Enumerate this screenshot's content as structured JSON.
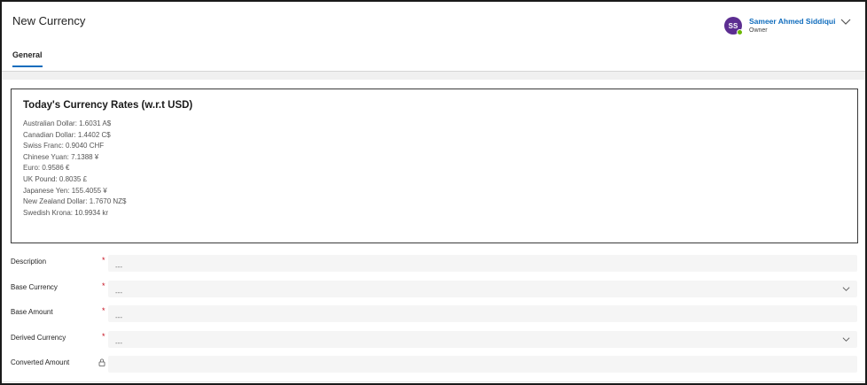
{
  "header": {
    "title": "New Currency",
    "owner": {
      "initials": "SS",
      "name": "Sameer Ahmed Siddiqui",
      "role": "Owner",
      "avatar_color": "#5c2d91",
      "presence_color": "#6bb700"
    },
    "tabs": [
      {
        "label": "General",
        "active": true
      }
    ]
  },
  "rates": {
    "title": "Today's Currency Rates (w.r.t USD)",
    "items": [
      "Australian Dollar: 1.6031 A$",
      "Canadian Dollar: 1.4402 C$",
      "Swiss Franc: 0.9040 CHF",
      "Chinese Yuan: 7.1388 ¥",
      "Euro: 0.9586 €",
      "UK Pound: 0.8035 £",
      "Japanese Yen: 155.4055 ¥",
      "New Zealand Dollar: 1.7670 NZ$",
      "Swedish Krona: 10.9934 kr"
    ]
  },
  "form": {
    "description": {
      "label": "Description",
      "required": "*",
      "value": "---"
    },
    "base_currency": {
      "label": "Base Currency",
      "required": "*",
      "value": "---"
    },
    "base_amount": {
      "label": "Base Amount",
      "required": "*",
      "value": "---"
    },
    "derived_currency": {
      "label": "Derived Currency",
      "required": "*",
      "value": "---"
    },
    "converted_amount": {
      "label": "Converted Amount",
      "value": "",
      "locked": true
    }
  },
  "colors": {
    "accent": "#0f6cbd",
    "required": "#c50f1f"
  }
}
